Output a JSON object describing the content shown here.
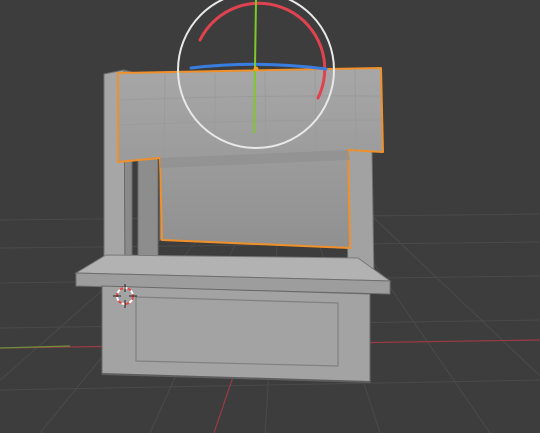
{
  "viewport": {
    "view_mode": "perspective",
    "active_tool": "rotate",
    "selected_object": "awning",
    "colors": {
      "background": "#3d3d3d",
      "grid": "#4a4a4a",
      "x_axis": "#9a3a45",
      "y_axis": "#6e8f3a",
      "selection_outline": "#f0902a",
      "gizmo_x": "#e0434f",
      "gizmo_y": "#7ec82a",
      "gizmo_z": "#3a7de0",
      "gizmo_trackball": "#e8e8e8"
    }
  }
}
